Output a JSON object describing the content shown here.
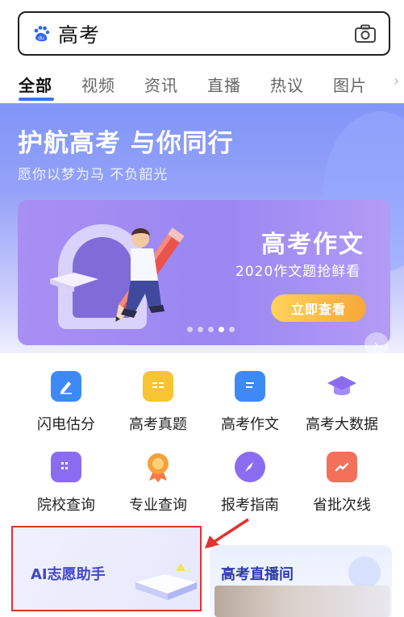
{
  "search": {
    "query": "高考"
  },
  "tabs": [
    {
      "label": "全部",
      "active": true
    },
    {
      "label": "视频"
    },
    {
      "label": "资讯"
    },
    {
      "label": "直播"
    },
    {
      "label": "热议"
    },
    {
      "label": "图片"
    }
  ],
  "hero": {
    "title": "护航高考 与你同行",
    "subtitle": "愿你以梦为马 不负韶光",
    "banner": {
      "title": "高考作文",
      "subtitle": "2020作文题抢鲜看",
      "button": "立即查看"
    }
  },
  "grid": [
    {
      "label": "闪电估分",
      "icon": "pen-icon",
      "color": "#3d8af7"
    },
    {
      "label": "高考真题",
      "icon": "document-icon",
      "color": "#f7c531"
    },
    {
      "label": "高考作文",
      "icon": "essay-icon",
      "color": "#3d8af7"
    },
    {
      "label": "高考大数据",
      "icon": "graduation-cap-icon",
      "color": "#8b6cf0"
    },
    {
      "label": "院校查询",
      "icon": "building-icon",
      "color": "#8b6cf0"
    },
    {
      "label": "专业查询",
      "icon": "medal-icon",
      "color": "#f5a13a"
    },
    {
      "label": "报考指南",
      "icon": "compass-icon",
      "color": "#8b6cf0"
    },
    {
      "label": "省批次线",
      "icon": "trend-chart-icon",
      "color": "#f3705a"
    }
  ],
  "cards": {
    "ai": "AI志愿助手",
    "live": "高考直播间"
  },
  "colors": {
    "accent": "#3b73f0",
    "highlight": "#e0322f"
  }
}
